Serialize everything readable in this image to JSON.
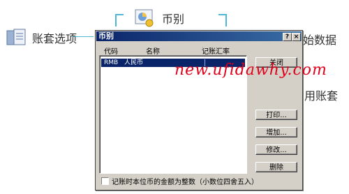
{
  "flowchart": {
    "left_node": "账套选项",
    "top_node": "币别",
    "right_node_top": "始数据",
    "right_node_bottom": "用账套"
  },
  "dialog": {
    "title": "币别",
    "help_button": "?",
    "close_button": "×",
    "columns": [
      "代码",
      "名称",
      "记账汇率"
    ],
    "rows": [
      {
        "code": "RMB",
        "name": "人民币",
        "rate": ""
      }
    ],
    "buttons": {
      "close": "关闭",
      "print": "打印...",
      "add": "增加...",
      "edit": "修改...",
      "delete": "删除"
    },
    "checkbox_label": "记账时本位币的金额为整数（小数位四舍五入）",
    "checkbox_checked": false
  },
  "watermark": "new.ufidawhy.com",
  "colors": {
    "title_bar": "#0a246a",
    "watermark": "#e0001a",
    "bracket": "#4fb7d6"
  }
}
